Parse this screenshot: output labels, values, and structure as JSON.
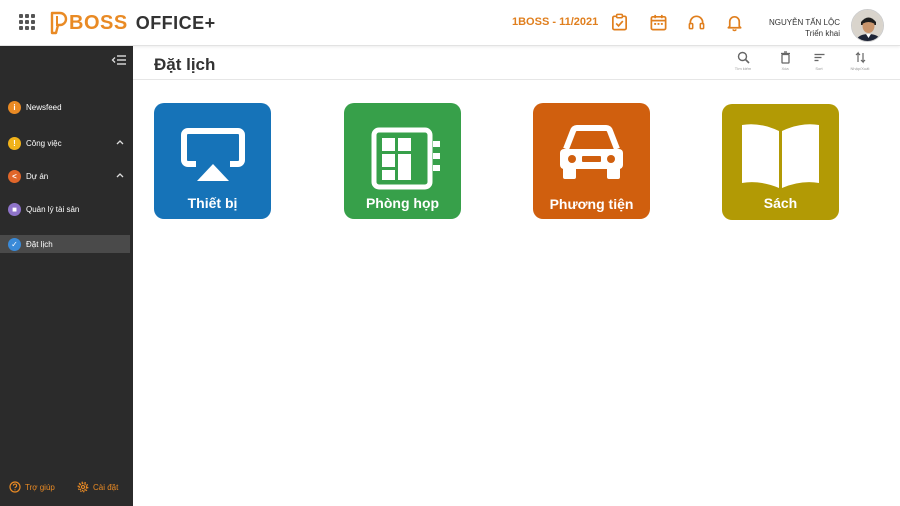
{
  "header": {
    "logo_text": "BOSS",
    "logo_sub": "OFFICE+",
    "period": "1BOSS - 11/2021",
    "user_name": "NGUYỄN TẤN LỘC",
    "user_role": "Triển khai"
  },
  "sidebar": {
    "items": [
      {
        "label": "Newsfeed",
        "color": "#e98a24",
        "glyph": "i"
      },
      {
        "label": "Công việc",
        "color": "#f1b21a",
        "glyph": "!"
      },
      {
        "label": "Dự án",
        "color": "#e0662a",
        "glyph": "<"
      },
      {
        "label": "Quản lý tài sản",
        "color": "#8e73c9",
        "glyph": "■"
      },
      {
        "label": "Đặt lịch",
        "color": "#3a8ad8",
        "glyph": "✓"
      }
    ],
    "help": "Trợ giúp",
    "settings": "Cài đặt"
  },
  "page": {
    "title": "Đặt lịch",
    "tools": {
      "search": "Tìm kiếm",
      "delete": "Xóa",
      "sort": "Sort",
      "import_export": "Nhập/Xuất"
    }
  },
  "tiles": [
    {
      "label": "Thiết bị",
      "color": "#1673b8"
    },
    {
      "label": "Phòng họp",
      "color": "#37a04a"
    },
    {
      "label": "Phương tiện",
      "color": "#d05f0e"
    },
    {
      "label": "Sách",
      "color": "#b29a05"
    }
  ]
}
